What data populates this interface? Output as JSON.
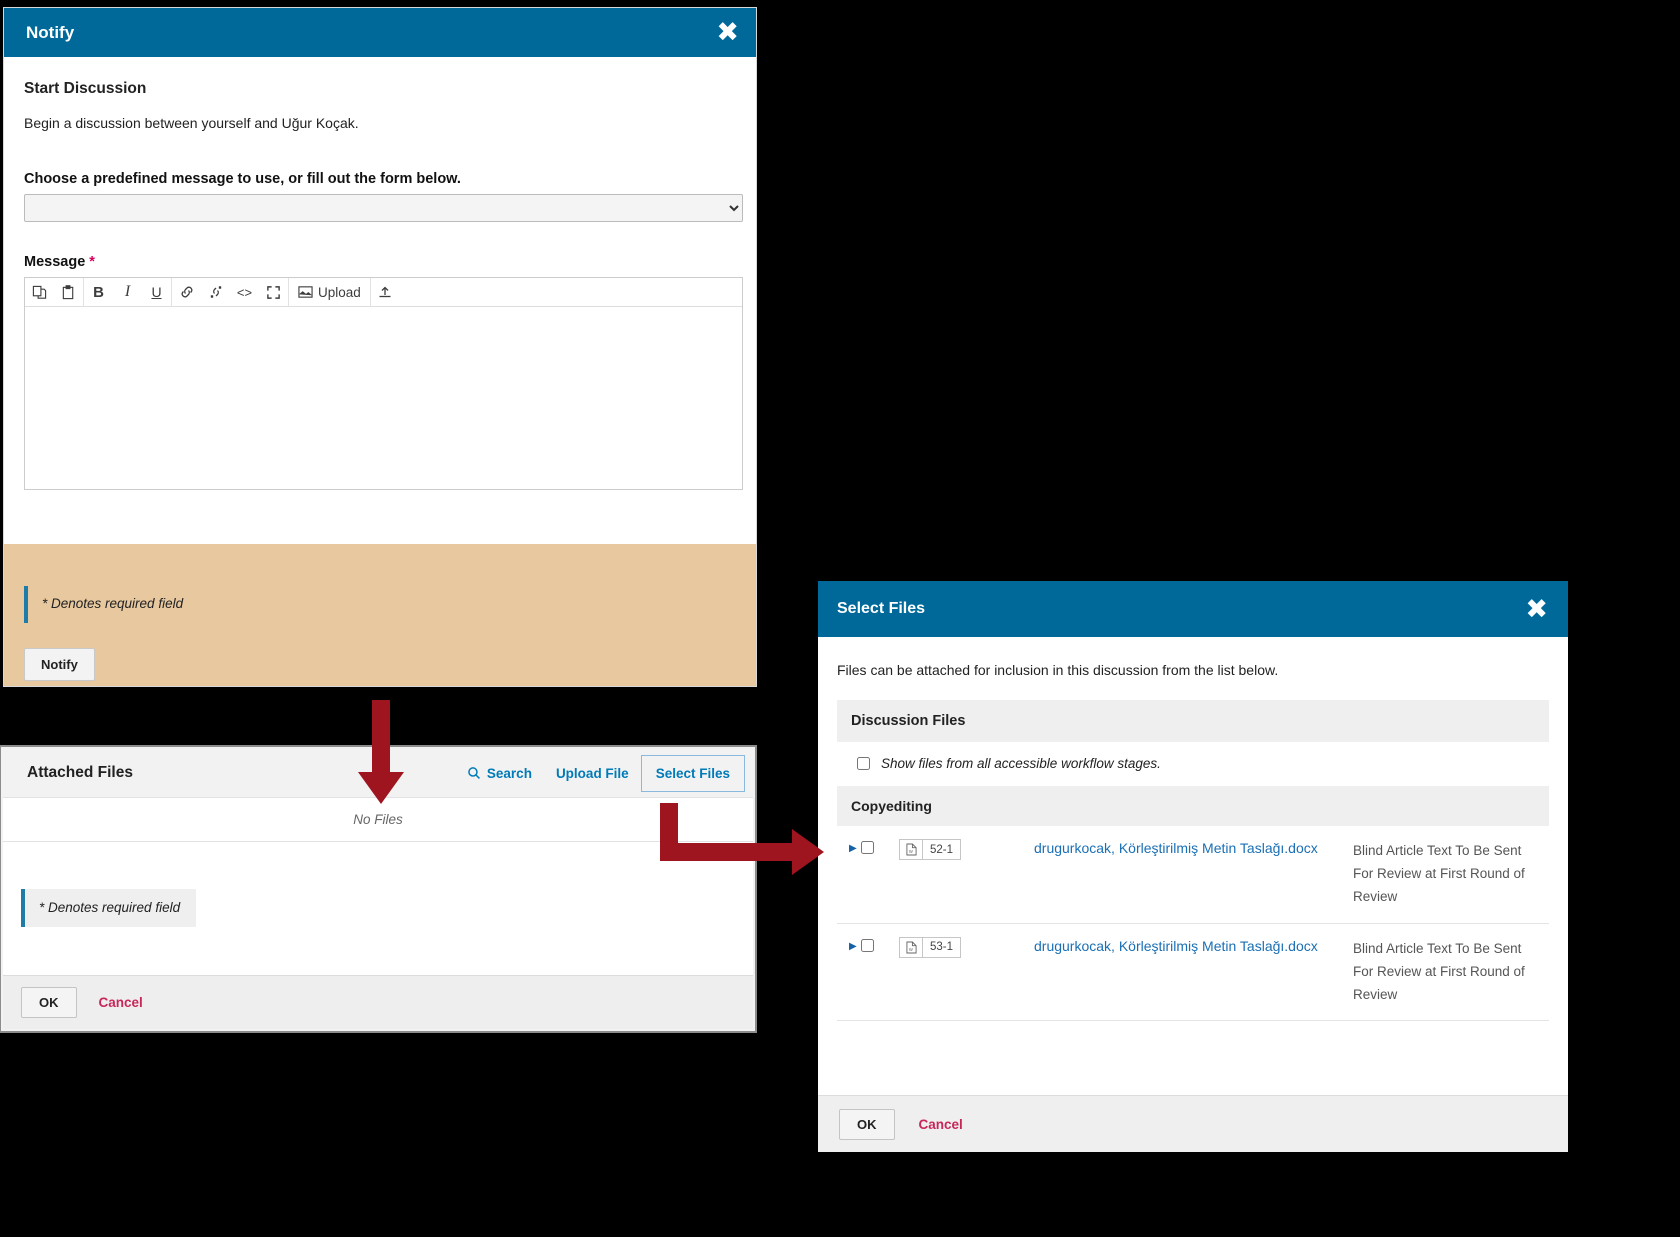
{
  "notify": {
    "title": "Notify",
    "close_label": "✖",
    "section_title": "Start Discussion",
    "section_desc": "Begin a discussion between yourself and Uğur Koçak.",
    "predefined_label": "Choose a predefined message to use, or fill out the form below.",
    "predefined_value": "",
    "message_label": "Message",
    "required_marker": "*",
    "message_value": "",
    "toolbar": [
      {
        "name": "copy-icon",
        "glyph": "⧉",
        "label": ""
      },
      {
        "name": "paste-icon",
        "glyph": "📋",
        "label": ""
      },
      {
        "name": "bold-icon",
        "glyph": "B",
        "label": ""
      },
      {
        "name": "italic-icon",
        "glyph": "I",
        "label": ""
      },
      {
        "name": "underline-icon",
        "glyph": "U",
        "label": ""
      },
      {
        "name": "link-icon",
        "glyph": "🔗",
        "label": ""
      },
      {
        "name": "unlink-icon",
        "glyph": "⛓",
        "label": ""
      },
      {
        "name": "code-icon",
        "glyph": "<>",
        "label": ""
      },
      {
        "name": "fullscreen-icon",
        "glyph": "⤢",
        "label": ""
      },
      {
        "name": "image-upload-icon",
        "glyph": "🖼",
        "label": "Upload"
      },
      {
        "name": "insert-file-icon",
        "glyph": "⬆",
        "label": ""
      }
    ],
    "required_note": "* Denotes required field",
    "submit_label": "Notify",
    "header_color": "#00699a",
    "footer_color": "#e7c89f"
  },
  "attached_files": {
    "title": "Attached Files",
    "search_label": "Search",
    "search_icon": "search-icon",
    "upload_label": "Upload File",
    "select_label": "Select Files",
    "empty_label": "No Files",
    "required_note": "* Denotes required field",
    "ok_label": "OK",
    "cancel_label": "Cancel",
    "link_color": "#007ab8",
    "cancel_color": "#c8275a"
  },
  "select_files": {
    "title": "Select Files",
    "close_label": "✖",
    "description": "Files can be attached for inclusion in this discussion from the list below.",
    "grid_header": "Discussion Files",
    "show_all_label": "Show files from all accessible workflow stages.",
    "show_all_checked": false,
    "stage_label": "Copyediting",
    "rows": [
      {
        "expander": "▶",
        "checked": false,
        "file_icon": "word-document-icon",
        "revision": "52-1",
        "filename": "drugurkocak, Körleştirilmiş Metin Taslağı.docx",
        "meta": "Blind Article Text To Be Sent For Review at First Round of Review"
      },
      {
        "expander": "▶",
        "checked": false,
        "file_icon": "word-document-icon",
        "revision": "53-1",
        "filename": "drugurkocak, Körleştirilmiş Metin Taslağı.docx",
        "meta": "Blind Article Text To Be Sent For Review at First Round of Review"
      }
    ],
    "ok_label": "OK",
    "cancel_label": "Cancel",
    "header_color": "#00699a",
    "link_color": "#1a6fb5"
  },
  "annotations": {
    "arrow_color": "#9e1520",
    "down_arrow": "down-arrow-annotation",
    "right_arrow": "right-arrow-annotation"
  }
}
